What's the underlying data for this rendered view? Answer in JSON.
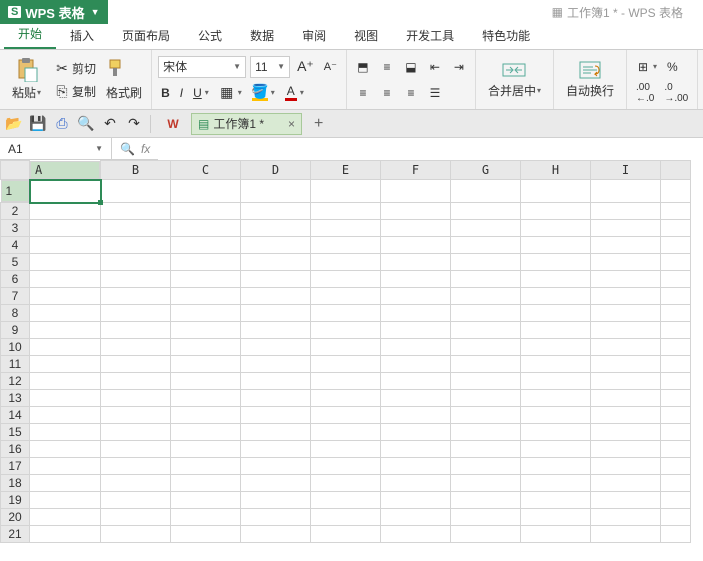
{
  "title": {
    "app": "WPS 表格",
    "doc": "工作簿1 * - WPS 表格"
  },
  "menu": {
    "tabs": [
      "开始",
      "插入",
      "页面布局",
      "公式",
      "数据",
      "审阅",
      "视图",
      "开发工具",
      "特色功能"
    ],
    "active": 0
  },
  "ribbon": {
    "paste": "粘贴",
    "cut": "剪切",
    "copy": "复制",
    "format_painter": "格式刷",
    "font_name": "宋体",
    "font_size": "11",
    "merge": "合并居中",
    "wrap": "自动换行"
  },
  "qa": {
    "doc_tab": "工作簿1 *"
  },
  "namebox": "A1",
  "formula": "",
  "grid": {
    "cols": [
      "A",
      "B",
      "C",
      "D",
      "E",
      "F",
      "G",
      "H",
      "I"
    ],
    "rows": 21,
    "selected": {
      "row": 1,
      "col": 0
    }
  }
}
